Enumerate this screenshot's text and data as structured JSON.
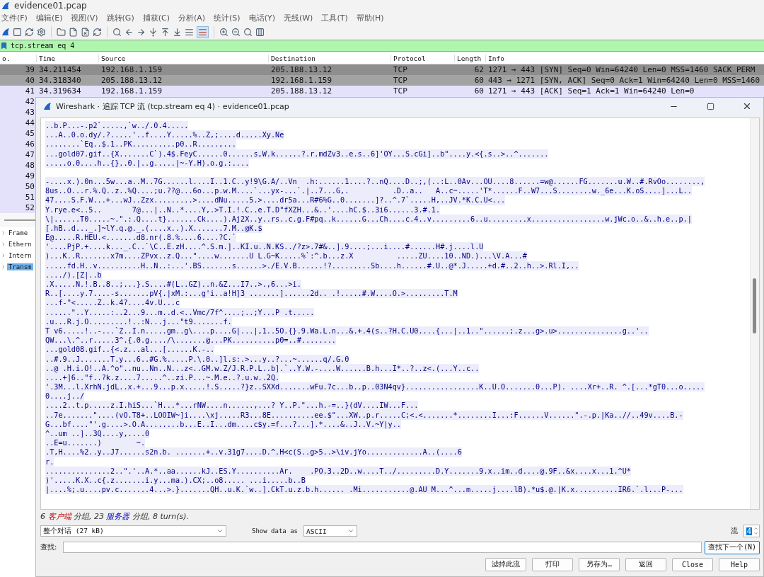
{
  "main_window": {
    "title": "evidence01.pcap",
    "menu": [
      "文件(F)",
      "编辑(E)",
      "视图(V)",
      "跳转(G)",
      "捕获(C)",
      "分析(A)",
      "统计(S)",
      "电话(Y)",
      "无线(W)",
      "工具(T)",
      "帮助(H)"
    ],
    "filter": {
      "value": "tcp.stream eq 4"
    },
    "packet_list": {
      "columns": [
        "o.",
        "Time",
        "Source",
        "Destination",
        "Protocol",
        "Length",
        "Info"
      ],
      "rows": [
        {
          "cells": [
            "39",
            "34.211454",
            "192.168.1.159",
            "205.188.13.12",
            "TCP",
            "62",
            "1271 → 443 [SYN] Seq=0 Win=64240 Len=0 MSS=1460 SACK_PERM"
          ],
          "color": "#8e8e8e"
        },
        {
          "cells": [
            "40",
            "34.318340",
            "205.188.13.12",
            "192.168.1.159",
            "TCP",
            "60",
            "443 → 1271 [SYN, ACK] Seq=0 Ack=1 Win=64240 Len=0 MSS=1460"
          ],
          "color": "#a3a3a3"
        },
        {
          "cells": [
            "41",
            "34.319634",
            "192.168.1.159",
            "205.188.13.12",
            "TCP",
            "60",
            "1271 → 443 [ACK] Seq=1 Ack=1 Win=64240 Len=0"
          ],
          "color": "#e4e2fb"
        },
        {
          "cells": [
            "42"
          ],
          "color": "#e4e2fb"
        },
        {
          "cells": [
            "43"
          ],
          "color": "#e4e2fb"
        },
        {
          "cells": [
            "44"
          ],
          "color": "#e4e2fb"
        },
        {
          "cells": [
            "45"
          ],
          "color": "#e4e2fb"
        },
        {
          "cells": [
            "46"
          ],
          "color": "#e4e2fb"
        },
        {
          "cells": [
            "47"
          ],
          "color": "#e4e2fb"
        },
        {
          "cells": [
            "48"
          ],
          "color": "#e4e2fb"
        },
        {
          "cells": [
            "49"
          ],
          "color": "#e4e2fb"
        },
        {
          "cells": [
            "50"
          ],
          "color": "#e4e2fb"
        },
        {
          "cells": [
            "51"
          ],
          "color": "#e4e2fb"
        },
        {
          "cells": [
            "52"
          ],
          "color": "#e4e2fb"
        }
      ]
    },
    "detail": [
      {
        "label": "Frame",
        "expanded": false,
        "selected": false
      },
      {
        "label": "Ethern",
        "expanded": false,
        "selected": false
      },
      {
        "label": "Intern",
        "expanded": false,
        "selected": false
      },
      {
        "label": "Transm",
        "expanded": false,
        "selected": true
      }
    ]
  },
  "dialog": {
    "title": "Wireshark · 追踪 TCP 流 (tcp.stream eq 4) · evidence01.pcap",
    "stream": [
      {
        "lines": [
          "..b.P...-.p2`.....,`w../.0.4.....",
          "...A..0.o.dy/.?.....'..f....Y.....%..Z,;....d.....Xy.Ne",
          "........`Eq..$.1..PK..........p0..R.....,...",
          "...gold07.gif..{X.......C`).4$.FeyC......0......s,W.k......?.r.mdZv3..e.s..6]'OY...S.cGi]..b\"....y.<{.s..>..^.......",
          ".....o.0....h..{}..0.|..g.....|~-Y.H).o.g.:...."
        ]
      },
      {
        "lines": [
          "-....x.).0n...5w...a..M..7G......l....I..1.C..y!9\\G.A/..Vn  .h:......1....?..nQ....D..;,(..:L..0Av...OU....8......=w@......FG.......u.W..#.RvOo........,",
          "8us..O...r.%.Q..z..%Q....;u.??@...6o...p.w.M....`...yx-...`.|..7...G,.          .D..a..   A..c~.....'T*......F..W7...S........w._6e...K.oS....]...L..",
          "47....S.F.W...+...wJ..Zzx.........>....dNu.....5.>....dr5a...R#6%G..0.......]?..^.7`.....H,..JV.*K.C.U<...",
          "Y.rye.e<..5..       7@...|..N..*....Y,.>T.I.!.C..e.T.D\"fXZH...&..'....hC.$..3i6......3.#.1.",
          "\\|......T0.....~.\".:.Q....t}.......Ck....).Aj2X..y..rs..c.g.F#pq..k......G...Ch....c.4..v.........6..u.........x.................w.jWc.o..&..h.e..p.|",
          "[.hB..d..._.]~lY.q.@._.(....x..).X.......7.M..@K.$",
          "E@.....R.HEU.<.......d8.nr(.8.%....6....?C.`",
          "'....PjP.+....k..._.C..`\\C..E.zH....^.S.m.]..KI.u..N.KS../?z>.7#&..].9....;...i....#......H#.j....l.U",
          ")...K..R.......x7m....ZPvx..z.Q...\"....w.......U L.G~K.....%`:^.b...z.X          .....ZU....10..ND.)...\\V.A...#",
          ".....fd.H..v..........H..N..:...'.BS.......s......>./E.V.B......!?.........Sb....h......#.U..@*.J.....+d.#..2..h..>.Rl.I,..",
          "..../).[Z|..b",
          ".X.....N.!.B..8..;...}.S....#(L..GZ)..n.&Z...I7..>.,6...>i.",
          "R..[....y.7....-s.......pV{.|xM.:...g'i..a!H]3 .......]......2d.. .!.....#.W....O.>.........T.M",
          "...f-\"<.....Z..k.4?....4v.U...c",
          "......\"..Y.....:..2...9...m..d.<..Vmc/7f^....;..;Y...P .t.....",
          ".u...R.j.O.........!..:N...j...\"t9.......f.",
          "T v6.....!..-...`Z..I.n.....gm..g\\....p....G|...|,1..5O.{}.9.Wa.L.n...&.+.4(s..?H.C.U0....{...|..1..\"......;.z...g>.u>...............g..'..",
          "QW...\\.^..r.....3^.{.0.g..../\\.......@...PK..........p0=..#........",
          "...gold08.gif..{<.z...al...[......K.-..",
          "..#.9..J.......T.y...6..#G.%.....P.\\.0..]l.s:.>...y..?...~......q/.G.0",
          "..@ .H.i.O!..A.^o\"..nu..Nn..N...z<..GM.w.Z/J.R.P.L..b].`..Y.W.-....W......B.h...I*..?..z<.(...Y..c..",
          "....+]6..\"f..?k.z....7.....^..zi.P...~.M.e..?.u.w..2Q.",
          "'.3M...l.XrhN.jdL..x.+...9...p.x.....!.S.....?}z..SXXd.......wFu.7c...b..p..03N4qv}.................K..U.O.......0...P). ....Xr+..R. ^.[...*gT0...o.....",
          "0....j../",
          "....2..t.p.....z.I.hiS...`H...*...rNW....n......,...? Y..P.\"...h.-=..}(dV....IW...F...",
          "..7e.......\"....(vO.T8+..LOOIW~]i....\\xj.....R3...8E..........ee.$\"...XW..p.r.....C;<.<.......*........I...:F......V......\".-.p.|Ka..//..49v....B.-",
          "G...bf....\"'.g....>.O.A........b...E..I...dm....c$y.=f...?...].*....&..J..V.~Y|y..",
          "^..um ..]..3Q....y,....0",
          "..E=u.......)        ~.",
          ".T,H....%2..y..J7......s2n.b. .......+..v.31g7....D.^.H<c(S..g>5..>\\iv.jYo.............A..(....6",
          "r.",
          "...............2..\".'..A.*..aa......kJ..ES.Y..........Ar.    .PO.3..2D..w....T../.........D.Y.......9.x..im..d....@.9F..&x....x...1.^U*",
          ")'.....K.X..c{.z.......i.y...ma.).CX;..o8..... ...i.....b..B",
          "|....%;.u....pv.c.......4...>.}.......QH..u.K.`w..].CkT.u.z.b.h...... .Mi...........@.AU M...^...m.....j....lB).*u$.@.|K.x..........IR6.`.l...P-..."
        ]
      }
    ],
    "status": [
      {
        "text": "6 ",
        "kind": "plain"
      },
      {
        "text": "客户端",
        "kind": "client"
      },
      {
        "text": " 分组, 23 ",
        "kind": "plain"
      },
      {
        "text": "服务器",
        "kind": "server"
      },
      {
        "text": " 分组, 8 turn(s).",
        "kind": "plain"
      }
    ],
    "conversation_select": {
      "value": "整个对话 (27 kB)"
    },
    "show_data_as": {
      "label": "Show data as",
      "value": "ASCII"
    },
    "stream_number": {
      "label": "流",
      "value": "4"
    },
    "find": {
      "label": "查找:",
      "button": "查找下一个(N)"
    },
    "buttons": [
      "滤掉此流",
      "打印",
      "另存为…",
      "返回",
      "Close",
      "Help"
    ]
  }
}
